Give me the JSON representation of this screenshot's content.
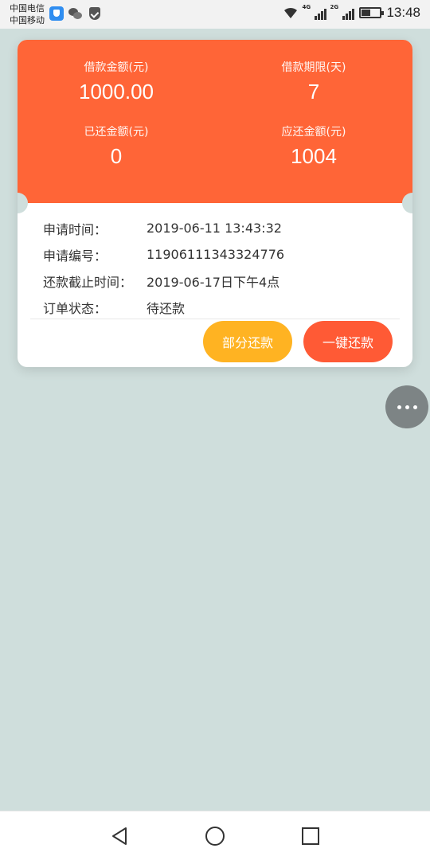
{
  "status_bar": {
    "carrier_1": "中国电信",
    "carrier_2": "中国移动",
    "net_1": "4G",
    "net_2": "2G",
    "time": "13:48",
    "icons": [
      "app-shield-icon",
      "wechat-icon",
      "security-shield-icon",
      "wifi-icon",
      "signal-icon",
      "battery-icon"
    ]
  },
  "loan_summary": {
    "amount_label": "借款金额(元)",
    "amount_value": "1000.00",
    "term_label": "借款期限(天)",
    "term_value": "7",
    "repaid_label": "已还金额(元)",
    "repaid_value": "0",
    "due_label": "应还金额(元)",
    "due_value": "1004"
  },
  "details": [
    {
      "key": "申请时间：",
      "value": "2019-06-11 13:43:32"
    },
    {
      "key": "申请编号：",
      "value": "11906111343324776"
    },
    {
      "key": "还款截止时间：",
      "value": "2019-06-17日下午4点"
    },
    {
      "key": "订单状态：",
      "value": "待还款"
    }
  ],
  "actions": {
    "partial_label": "部分还款",
    "full_label": "一键还款"
  },
  "colors": {
    "header": "#ff6537",
    "partial_button": "#ffb322",
    "full_button": "#ff5a35",
    "background": "#cfdedc"
  },
  "floating_button": {
    "icon": "more-dots-icon"
  },
  "nav_bar": {
    "icons": [
      "back-icon",
      "home-icon",
      "recents-icon"
    ]
  }
}
